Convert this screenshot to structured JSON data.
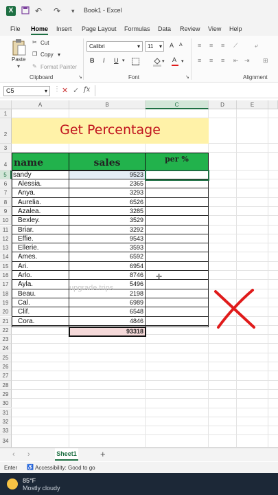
{
  "titlebar": {
    "app_letter": "X",
    "title": "Book1 - Excel",
    "undo": "↶",
    "redo": "↷",
    "more": "▾"
  },
  "tabs": [
    "File",
    "Home",
    "Insert",
    "Page Layout",
    "Formulas",
    "Data",
    "Review",
    "View",
    "Help"
  ],
  "ribbon": {
    "paste": "Paste",
    "cut": "Cut",
    "copy": "Copy",
    "format_painter": "Format Painter",
    "font_name": "Calibri",
    "font_size": "11",
    "bold": "B",
    "italic": "I",
    "underline": "U",
    "groups": {
      "clipboard": "Clipboard",
      "font": "Font",
      "alignment": "Alignment"
    }
  },
  "formula_bar": {
    "name_box": "C5",
    "fx": "fx",
    "value": ""
  },
  "grid": {
    "columns": [
      "A",
      "B",
      "C",
      "D",
      "E"
    ],
    "rows": [
      "1",
      "2",
      "3",
      "4",
      "5",
      "6",
      "7",
      "8",
      "9",
      "10",
      "11",
      "12",
      "13",
      "14",
      "15",
      "16",
      "17",
      "18",
      "19",
      "20",
      "21",
      "22",
      "23",
      "24",
      "25",
      "26",
      "27",
      "28",
      "29",
      "30",
      "31",
      "32",
      "33",
      "34"
    ],
    "title": "Get Percentage",
    "headers": {
      "name": "name",
      "sales": "sales",
      "per": "per %"
    },
    "records": [
      {
        "name": "sandy",
        "sales": "9523"
      },
      {
        "name": "Alessia.",
        "sales": "2365"
      },
      {
        "name": "Anya.",
        "sales": "3293"
      },
      {
        "name": "Aurelia.",
        "sales": "6526"
      },
      {
        "name": "Azalea.",
        "sales": "3285"
      },
      {
        "name": "Bexley.",
        "sales": "3529"
      },
      {
        "name": "Briar.",
        "sales": "3292"
      },
      {
        "name": "Effie.",
        "sales": "9543"
      },
      {
        "name": "Ellerie.",
        "sales": "3593"
      },
      {
        "name": "Ames.",
        "sales": "6592"
      },
      {
        "name": "Ari.",
        "sales": "6954"
      },
      {
        "name": "Arlo.",
        "sales": "8746"
      },
      {
        "name": "Ayla.",
        "sales": "5496"
      },
      {
        "name": "Beau.",
        "sales": "2198"
      },
      {
        "name": "Cal.",
        "sales": "6989"
      },
      {
        "name": "Clif.",
        "sales": "6548"
      },
      {
        "name": "Cora.",
        "sales": "4846"
      }
    ],
    "total": "93318",
    "watermark": "upgrade trips"
  },
  "sheets": {
    "active": "Sheet1",
    "add": "+",
    "prev": "‹",
    "next": "›"
  },
  "status": {
    "mode": "Enter",
    "accessibility": "Accessibility: Good to go"
  },
  "taskbar": {
    "temp": "85°F",
    "condition": "Mostly cloudy"
  },
  "colors": {
    "accent": "#1d6f42",
    "header_green": "#22b24c",
    "title_band": "#fff2a8",
    "title_text": "#c0141e",
    "cross": "#e01b1b",
    "total_fill": "#f5d9d9"
  }
}
